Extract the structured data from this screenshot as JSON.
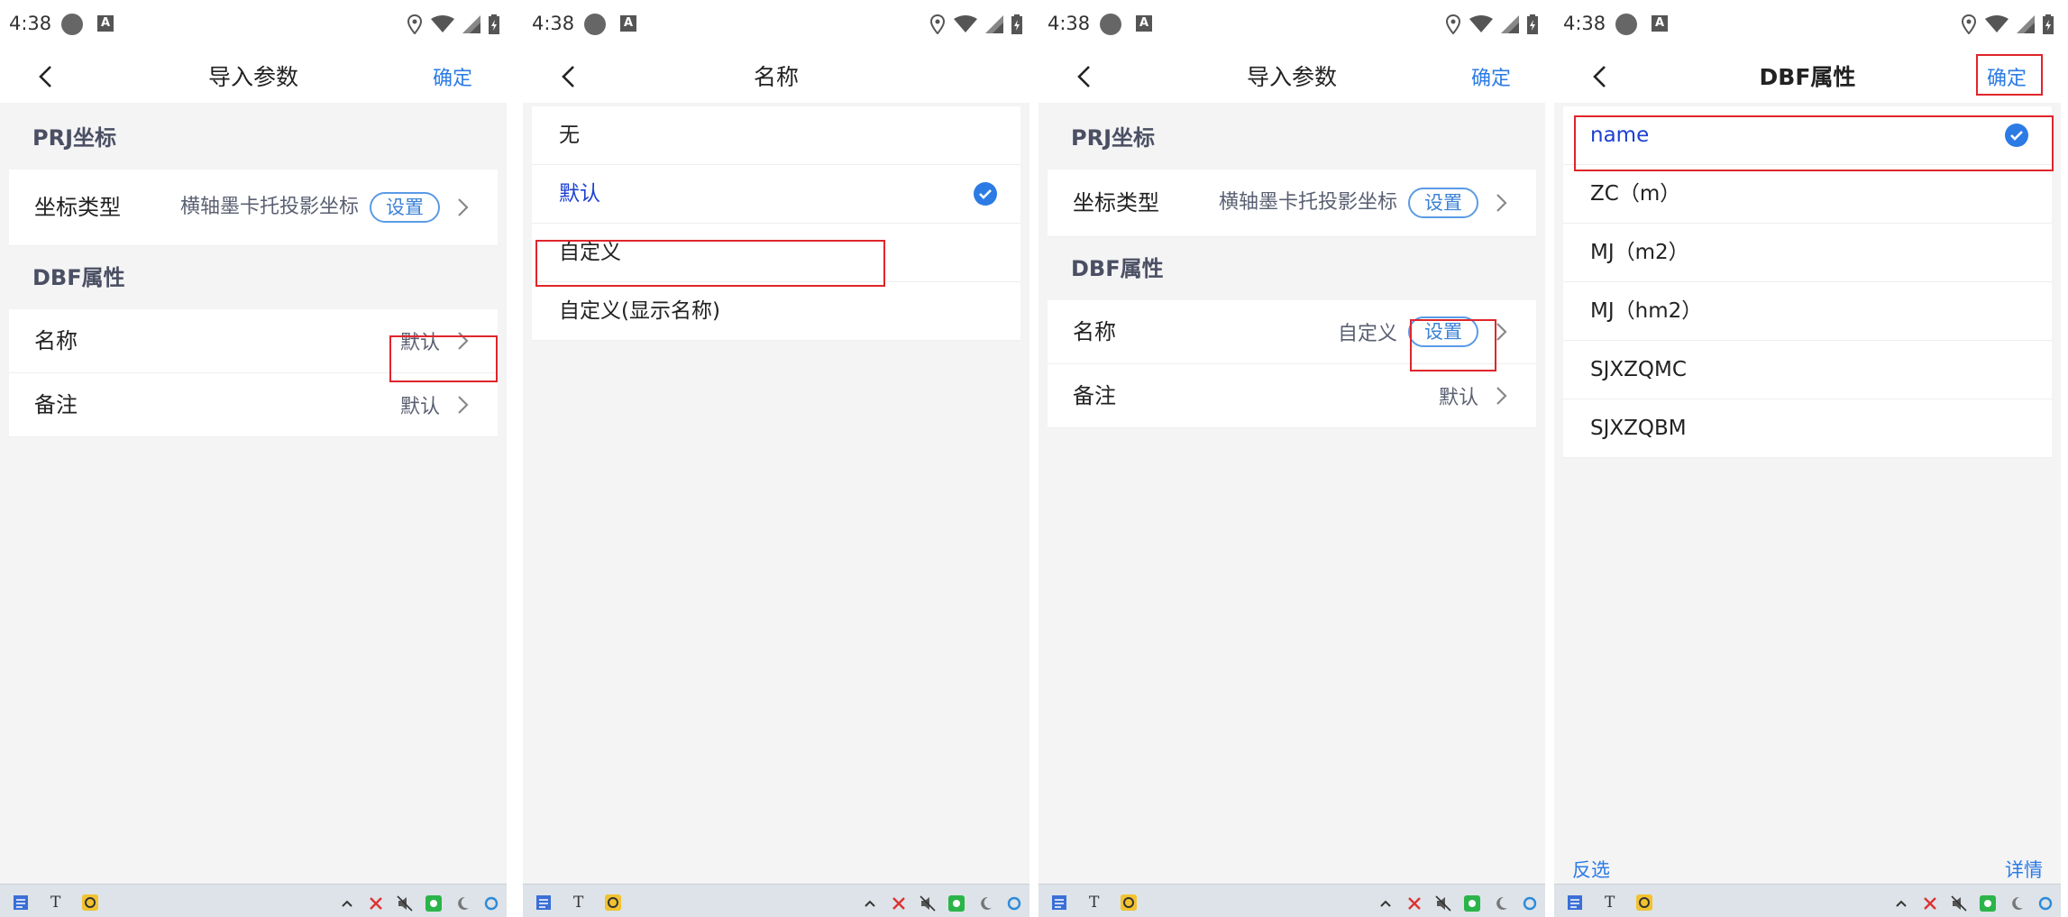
{
  "status_bar": {
    "time": "4:38"
  },
  "panel1": {
    "title": "导入参数",
    "confirm": "确定",
    "sections": {
      "prj": {
        "header": "PRJ坐标",
        "coord_label": "坐标类型",
        "coord_value": "横轴墨卡托投影坐标",
        "coord_button": "设置"
      },
      "dbf": {
        "header": "DBF属性",
        "name_label": "名称",
        "name_value": "默认",
        "remark_label": "备注",
        "remark_value": "默认"
      }
    }
  },
  "panel2": {
    "title": "名称",
    "options": [
      "无",
      "默认",
      "自定义",
      "自定义(显示名称)"
    ],
    "selected": "默认"
  },
  "panel3": {
    "title": "导入参数",
    "confirm": "确定",
    "sections": {
      "prj": {
        "header": "PRJ坐标",
        "coord_label": "坐标类型",
        "coord_value": "横轴墨卡托投影坐标",
        "coord_button": "设置"
      },
      "dbf": {
        "header": "DBF属性",
        "name_label": "名称",
        "name_value": "自定义",
        "name_button": "设置",
        "remark_label": "备注",
        "remark_value": "默认"
      }
    }
  },
  "panel4": {
    "title": "DBF属性",
    "confirm": "确定",
    "fields": [
      "name",
      "ZC（m）",
      "MJ（m2）",
      "MJ（hm2）",
      "SJXZQMC",
      "SJXZQBM"
    ],
    "selected": "name",
    "invert": "反选",
    "details": "详情"
  },
  "colors": {
    "accent": "#2c7be5",
    "selected_text": "#1c3fd1",
    "highlight": "#e0252b"
  }
}
